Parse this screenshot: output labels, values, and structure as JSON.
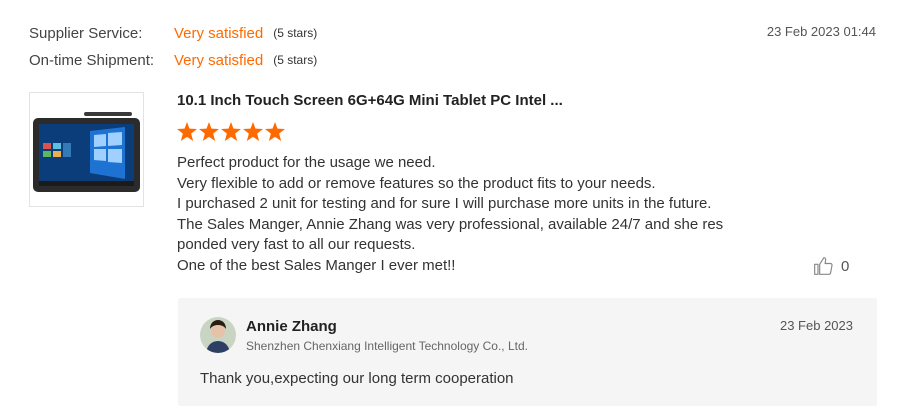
{
  "ratings": [
    {
      "label": "Supplier Service:",
      "value": "Very satisfied",
      "stars": "(5 stars)"
    },
    {
      "label": "On-time Shipment:",
      "value": "Very satisfied",
      "stars": "(5 stars)"
    }
  ],
  "review": {
    "date": "23 Feb 2023 01:44",
    "product_title": "10.1 Inch Touch Screen 6G+64G Mini Tablet PC Intel ...",
    "star_count": 5,
    "text_lines": [
      "Perfect product for the usage we need.",
      "Very flexible to add or remove features so the product fits to your needs.",
      "I purchased 2 unit for testing and for sure I will purchase more units in the future.",
      "The Sales Manger, Annie Zhang was very professional, available 24/7 and she res",
      "ponded very fast to all our requests.",
      "One of the best Sales Manger I ever met!!"
    ],
    "likes": "0"
  },
  "reply": {
    "name": "Annie Zhang",
    "company": "Shenzhen Chenxiang Intelligent Technology Co., Ltd.",
    "date": "23 Feb 2023",
    "text": "Thank you,expecting our long term cooperation"
  },
  "colors": {
    "accent": "#ff6a00",
    "star": "#ff6a00",
    "reply_bg": "#f5f5f5"
  },
  "icons": {
    "like": "thumbs-up-icon",
    "star": "star-icon"
  }
}
